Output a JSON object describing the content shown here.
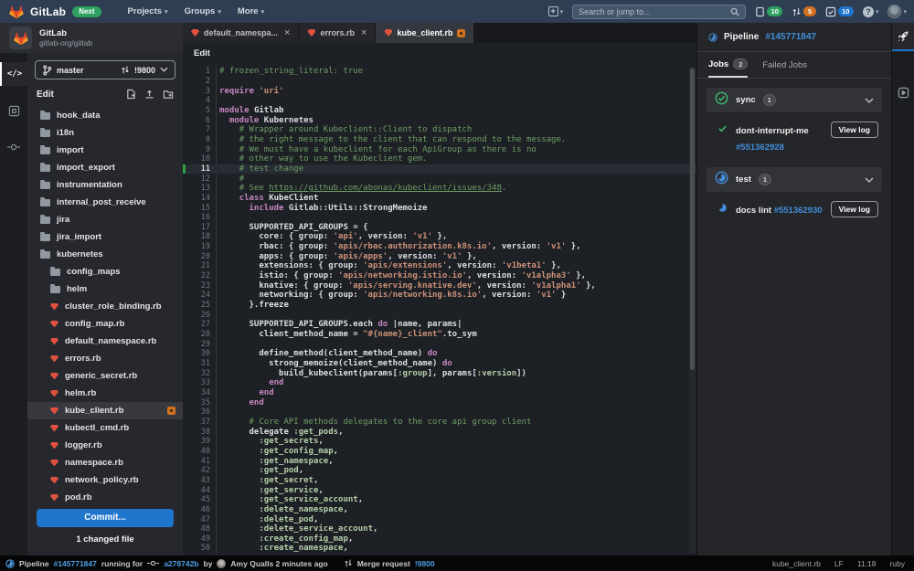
{
  "navbar": {
    "brand": "GitLab",
    "next_badge": "Next",
    "menus": [
      "Projects",
      "Groups",
      "More"
    ],
    "search_placeholder": "Search or jump to...",
    "counts": {
      "issues": "10",
      "merge_requests": "5",
      "todos": "10"
    },
    "help_glyph": "?",
    "plus_glyph": "+"
  },
  "project": {
    "name": "GitLab",
    "namespace": "gitlab-org/gitlab"
  },
  "branch_bar": {
    "branch": "master",
    "merge_request": "!9800"
  },
  "sidebar": {
    "panel_title": "Edit",
    "tree": [
      {
        "label": "hook_data",
        "type": "folder",
        "indent": 0
      },
      {
        "label": "i18n",
        "type": "folder",
        "indent": 0
      },
      {
        "label": "import",
        "type": "folder",
        "indent": 0
      },
      {
        "label": "import_export",
        "type": "folder",
        "indent": 0
      },
      {
        "label": "instrumentation",
        "type": "folder",
        "indent": 0
      },
      {
        "label": "internal_post_receive",
        "type": "folder",
        "indent": 0
      },
      {
        "label": "jira",
        "type": "folder",
        "indent": 0
      },
      {
        "label": "jira_import",
        "type": "folder",
        "indent": 0
      },
      {
        "label": "kubernetes",
        "type": "folder-open",
        "indent": 0
      },
      {
        "label": "config_maps",
        "type": "folder",
        "indent": 1
      },
      {
        "label": "helm",
        "type": "folder",
        "indent": 1
      },
      {
        "label": "cluster_role_binding.rb",
        "type": "ruby",
        "indent": 1
      },
      {
        "label": "config_map.rb",
        "type": "ruby",
        "indent": 1
      },
      {
        "label": "default_namespace.rb",
        "type": "ruby",
        "indent": 1
      },
      {
        "label": "errors.rb",
        "type": "ruby",
        "indent": 1
      },
      {
        "label": "generic_secret.rb",
        "type": "ruby",
        "indent": 1
      },
      {
        "label": "helm.rb",
        "type": "ruby",
        "indent": 1
      },
      {
        "label": "kube_client.rb",
        "type": "ruby",
        "indent": 1,
        "selected": true,
        "modified": true
      },
      {
        "label": "kubectl_cmd.rb",
        "type": "ruby",
        "indent": 1
      },
      {
        "label": "logger.rb",
        "type": "ruby",
        "indent": 1
      },
      {
        "label": "namespace.rb",
        "type": "ruby",
        "indent": 1
      },
      {
        "label": "network_policy.rb",
        "type": "ruby",
        "indent": 1
      },
      {
        "label": "pod.rb",
        "type": "ruby",
        "indent": 1
      }
    ],
    "commit_button": "Commit...",
    "changed_files": "1 changed file"
  },
  "editor": {
    "tabs": [
      {
        "label": "default_namespa...",
        "close": true
      },
      {
        "label": "errors.rb",
        "close": true
      },
      {
        "label": "kube_client.rb",
        "active": true,
        "modified": true
      }
    ],
    "breadcrumb": "Edit",
    "current_line": 11,
    "changed_lines": [
      11
    ],
    "lines": [
      [
        [
          "c",
          "# frozen_string_literal: true"
        ]
      ],
      [],
      [
        [
          "k",
          "require "
        ],
        [
          "s",
          "'uri'"
        ]
      ],
      [],
      [
        [
          "k",
          "module "
        ],
        [
          "b",
          "Gitlab"
        ]
      ],
      [
        [
          "b",
          "  "
        ],
        [
          "k",
          "module "
        ],
        [
          "b",
          "Kubernetes"
        ]
      ],
      [
        [
          "b",
          "    "
        ],
        [
          "c",
          "# Wrapper around Kubeclient::Client to dispatch"
        ]
      ],
      [
        [
          "b",
          "    "
        ],
        [
          "c",
          "# the right message to the client that can respond to the message."
        ]
      ],
      [
        [
          "b",
          "    "
        ],
        [
          "c",
          "# We must have a kubeclient for each ApiGroup as there is no"
        ]
      ],
      [
        [
          "b",
          "    "
        ],
        [
          "c",
          "# other way to use the Kubeclient gem."
        ]
      ],
      [
        [
          "b",
          "    "
        ],
        [
          "c",
          "# test change"
        ]
      ],
      [
        [
          "b",
          "    "
        ],
        [
          "c",
          "#"
        ]
      ],
      [
        [
          "b",
          "    "
        ],
        [
          "c",
          "# See "
        ],
        [
          "l",
          "https://github.com/abonas/kubeclient/issues/348"
        ],
        [
          "c",
          "."
        ]
      ],
      [
        [
          "b",
          "    "
        ],
        [
          "k",
          "class "
        ],
        [
          "b",
          "KubeClient"
        ]
      ],
      [
        [
          "b",
          "      "
        ],
        [
          "k",
          "include "
        ],
        [
          "b",
          "Gitlab::Utils::StrongMemoize"
        ]
      ],
      [],
      [
        [
          "b",
          "      SUPPORTED_API_GROUPS = {"
        ]
      ],
      [
        [
          "b",
          "        core: { group: "
        ],
        [
          "s",
          "'api'"
        ],
        [
          "b",
          ", version: "
        ],
        [
          "s",
          "'v1'"
        ],
        [
          "b",
          " },"
        ]
      ],
      [
        [
          "b",
          "        rbac: { group: "
        ],
        [
          "s",
          "'apis/rbac.authorization.k8s.io'"
        ],
        [
          "b",
          ", version: "
        ],
        [
          "s",
          "'v1'"
        ],
        [
          "b",
          " },"
        ]
      ],
      [
        [
          "b",
          "        apps: { group: "
        ],
        [
          "s",
          "'apis/apps'"
        ],
        [
          "b",
          ", version: "
        ],
        [
          "s",
          "'v1'"
        ],
        [
          "b",
          " },"
        ]
      ],
      [
        [
          "b",
          "        extensions: { group: "
        ],
        [
          "s",
          "'apis/extensions'"
        ],
        [
          "b",
          ", version: "
        ],
        [
          "s",
          "'v1beta1'"
        ],
        [
          "b",
          " },"
        ]
      ],
      [
        [
          "b",
          "        istio: { group: "
        ],
        [
          "s",
          "'apis/networking.istio.io'"
        ],
        [
          "b",
          ", version: "
        ],
        [
          "s",
          "'v1alpha3'"
        ],
        [
          "b",
          " },"
        ]
      ],
      [
        [
          "b",
          "        knative: { group: "
        ],
        [
          "s",
          "'apis/serving.knative.dev'"
        ],
        [
          "b",
          ", version: "
        ],
        [
          "s",
          "'v1alpha1'"
        ],
        [
          "b",
          " },"
        ]
      ],
      [
        [
          "b",
          "        networking: { group: "
        ],
        [
          "s",
          "'apis/networking.k8s.io'"
        ],
        [
          "b",
          ", version: "
        ],
        [
          "s",
          "'v1'"
        ],
        [
          "b",
          " }"
        ]
      ],
      [
        [
          "b",
          "      }.freeze"
        ]
      ],
      [],
      [
        [
          "b",
          "      SUPPORTED_API_GROUPS.each "
        ],
        [
          "k",
          "do"
        ],
        [
          "b",
          " |name, params|"
        ]
      ],
      [
        [
          "b",
          "        client_method_name = "
        ],
        [
          "s",
          "\"#{name}_client\""
        ],
        [
          "b",
          ".to_sym"
        ]
      ],
      [],
      [
        [
          "b",
          "        define_method(client_method_name) "
        ],
        [
          "k",
          "do"
        ]
      ],
      [
        [
          "b",
          "          strong_memoize(client_method_name) "
        ],
        [
          "k",
          "do"
        ]
      ],
      [
        [
          "b",
          "            build_kubeclient(params["
        ],
        [
          "y",
          ":group"
        ],
        [
          "b",
          "], params["
        ],
        [
          "y",
          ":version"
        ],
        [
          "b",
          "])"
        ]
      ],
      [
        [
          "b",
          "          "
        ],
        [
          "k",
          "end"
        ]
      ],
      [
        [
          "b",
          "        "
        ],
        [
          "k",
          "end"
        ]
      ],
      [
        [
          "b",
          "      "
        ],
        [
          "k",
          "end"
        ]
      ],
      [],
      [
        [
          "b",
          "      "
        ],
        [
          "c",
          "# Core API methods delegates to the core api group client"
        ]
      ],
      [
        [
          "b",
          "      delegate "
        ],
        [
          "y",
          ":get_pods"
        ],
        [
          "b",
          ","
        ]
      ],
      [
        [
          "b",
          "        "
        ],
        [
          "y",
          ":get_secrets"
        ],
        [
          "b",
          ","
        ]
      ],
      [
        [
          "b",
          "        "
        ],
        [
          "y",
          ":get_config_map"
        ],
        [
          "b",
          ","
        ]
      ],
      [
        [
          "b",
          "        "
        ],
        [
          "y",
          ":get_namespace"
        ],
        [
          "b",
          ","
        ]
      ],
      [
        [
          "b",
          "        "
        ],
        [
          "y",
          ":get_pod"
        ],
        [
          "b",
          ","
        ]
      ],
      [
        [
          "b",
          "        "
        ],
        [
          "y",
          ":get_secret"
        ],
        [
          "b",
          ","
        ]
      ],
      [
        [
          "b",
          "        "
        ],
        [
          "y",
          ":get_service"
        ],
        [
          "b",
          ","
        ]
      ],
      [
        [
          "b",
          "        "
        ],
        [
          "y",
          ":get_service_account"
        ],
        [
          "b",
          ","
        ]
      ],
      [
        [
          "b",
          "        "
        ],
        [
          "y",
          ":delete_namespace"
        ],
        [
          "b",
          ","
        ]
      ],
      [
        [
          "b",
          "        "
        ],
        [
          "y",
          ":delete_pod"
        ],
        [
          "b",
          ","
        ]
      ],
      [
        [
          "b",
          "        "
        ],
        [
          "y",
          ":delete_service_account"
        ],
        [
          "b",
          ","
        ]
      ],
      [
        [
          "b",
          "        "
        ],
        [
          "y",
          ":create_config_map"
        ],
        [
          "b",
          ","
        ]
      ],
      [
        [
          "b",
          "        "
        ],
        [
          "y",
          ":create_namespace"
        ],
        [
          "b",
          ","
        ]
      ]
    ]
  },
  "right_panel": {
    "pipeline_label": "Pipeline",
    "pipeline_id": "#145771847",
    "tabs": [
      {
        "label": "Jobs",
        "count": "2",
        "active": true
      },
      {
        "label": "Failed Jobs"
      }
    ],
    "stages": [
      {
        "name": "sync",
        "count": "1",
        "status": "success",
        "jobs": [
          {
            "name": "dont-interrupt-me",
            "id": "#551362928",
            "status": "success",
            "action": "View log",
            "wrap": true
          }
        ]
      },
      {
        "name": "test",
        "count": "1",
        "status": "running",
        "jobs": [
          {
            "name": "docs lint",
            "id": "#551362930",
            "status": "running",
            "action": "View log",
            "wrap": false
          }
        ]
      }
    ]
  },
  "status_bar": {
    "pipeline_label": "Pipeline",
    "pipeline_id": "#145771847",
    "running_text": "running for",
    "commit_sha": "a278742b",
    "by_text": "by",
    "author_line": "Amy Qualls 2 minutes ago",
    "mr_label": "Merge request",
    "mr_id": "!9800",
    "right": [
      "kube_client.rb",
      "LF",
      "11:18",
      "ruby"
    ]
  },
  "colors": {
    "accent_blue": "#1f75cb",
    "link_blue": "#428fdc",
    "success_green": "#2da160",
    "warning_orange": "#d1711f",
    "ruby_red": "#e0513f"
  }
}
